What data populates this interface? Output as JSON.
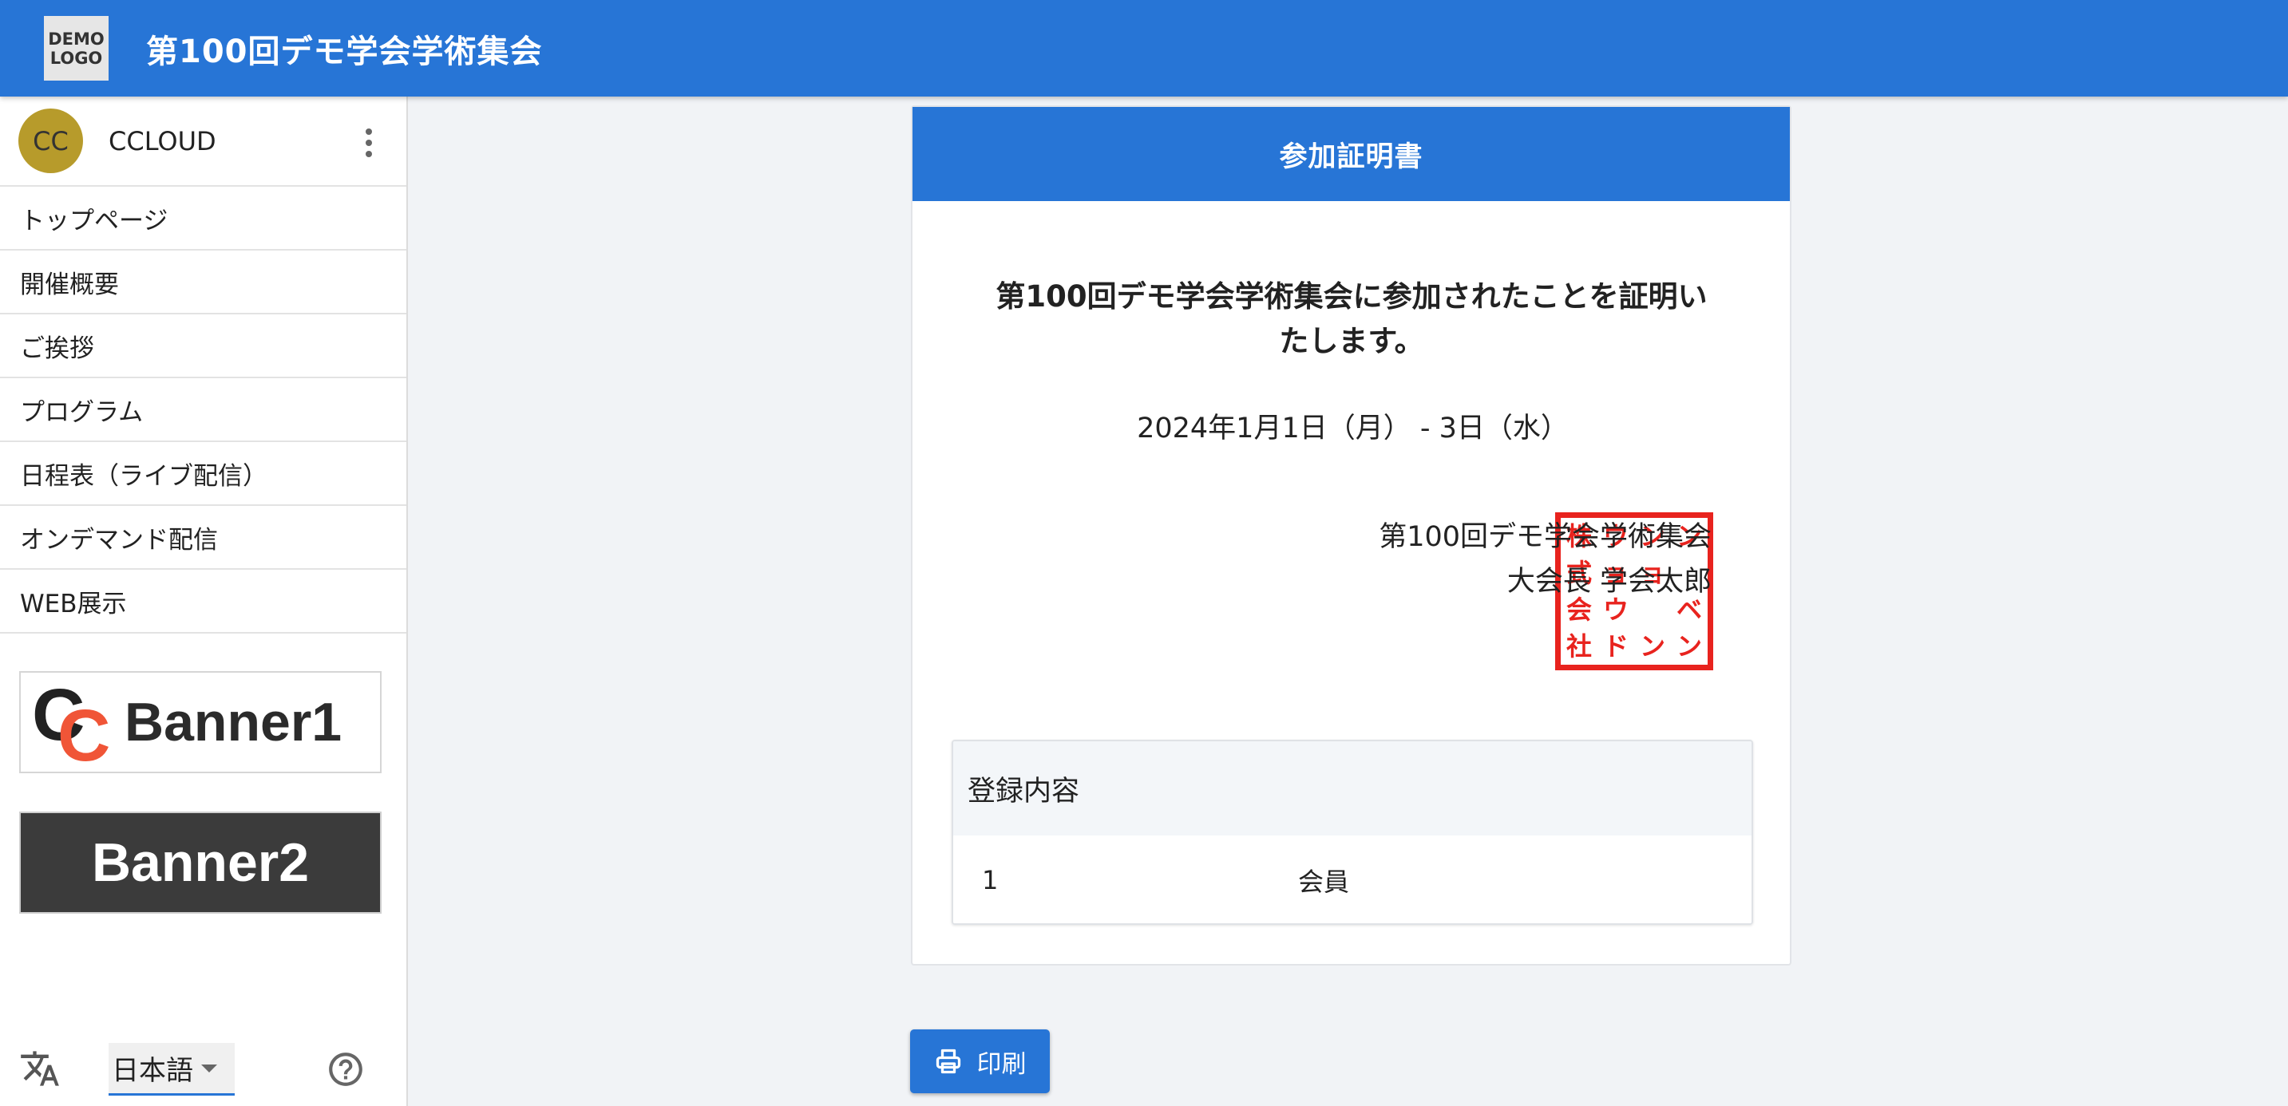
{
  "header": {
    "logo_line1": "DEMO",
    "logo_line2": "LOGO",
    "title": "第100回デモ学会学術集会"
  },
  "user": {
    "initials": "CC",
    "name": "CCLOUD"
  },
  "nav": {
    "items": [
      {
        "label": "トップページ"
      },
      {
        "label": "開催概要"
      },
      {
        "label": "ご挨拶"
      },
      {
        "label": "プログラム"
      },
      {
        "label": "日程表（ライブ配信）"
      },
      {
        "label": "オンデマンド配信"
      },
      {
        "label": "WEB展示"
      }
    ]
  },
  "banners": {
    "banner1_mark_1": "C",
    "banner1_mark_2": "C",
    "banner1_text": "Banner1",
    "banner2_text": "Banner2"
  },
  "footer": {
    "language": "日本語"
  },
  "certificate": {
    "header": "参加証明書",
    "text": "第100回デモ学会学術集会に参加されたことを証明いたします。",
    "date": "2024年1月1日（月） - 3日（水）",
    "signature_org": "第100回デモ学会学術集会",
    "signature_person": "大会長 学会太郎",
    "stamp_chars": [
      "株",
      "ウ",
      "ン",
      "ン",
      "式",
      "ョ",
      "ョ",
      "",
      "会",
      "ウ",
      "",
      "ベ",
      "社",
      "ド",
      "ン",
      "ン"
    ],
    "stamp_color": "#e8231e"
  },
  "registration": {
    "heading": "登録内容",
    "rows": [
      {
        "no": "1",
        "type": "会員"
      }
    ]
  },
  "actions": {
    "print_label": "印刷"
  },
  "colors": {
    "primary": "#2775d6",
    "avatar": "#b79b2b",
    "banner_accent": "#f05537"
  }
}
